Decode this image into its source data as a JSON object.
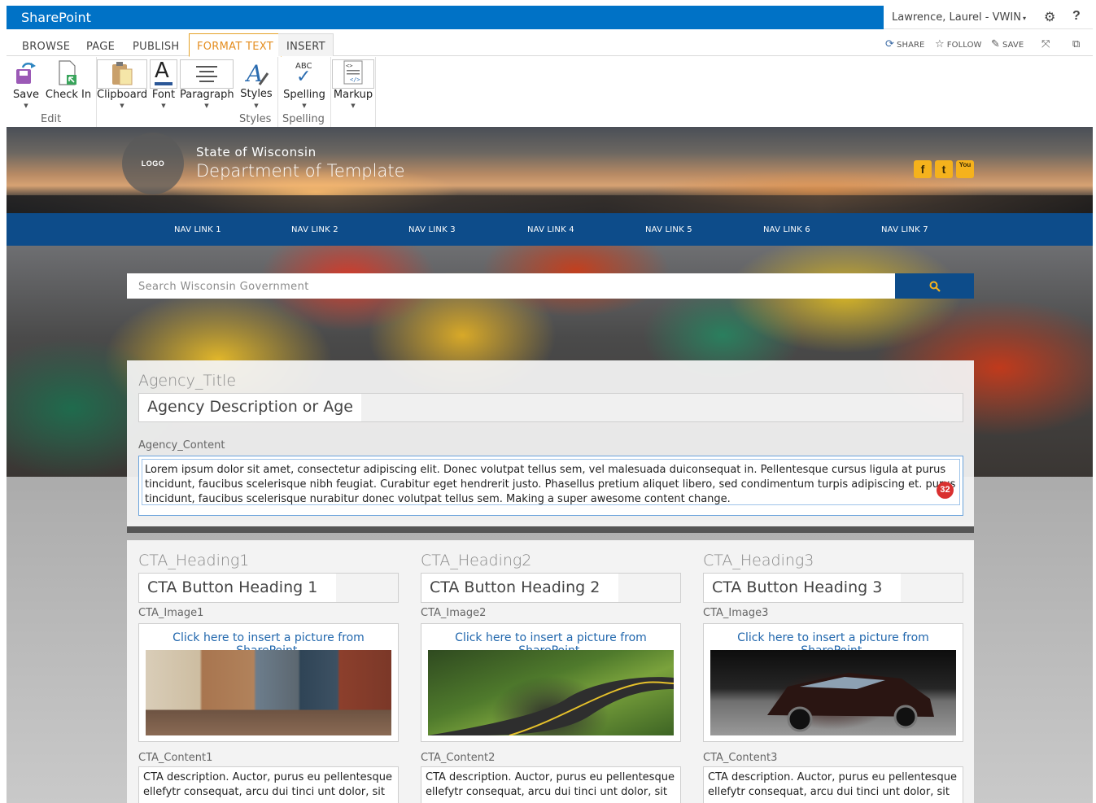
{
  "suitebar": {
    "brand": "SharePoint",
    "user": "Lawrence, Laurel - VWIN",
    "user_caret": "▾",
    "settings_icon": "gear-icon",
    "help": "?"
  },
  "ribbon": {
    "tabs": [
      "BROWSE",
      "PAGE",
      "PUBLISH",
      "FORMAT TEXT",
      "INSERT"
    ],
    "active_tab": "FORMAT TEXT",
    "actions": [
      "SHARE",
      "FOLLOW",
      "SAVE"
    ],
    "buttons": {
      "save": "Save",
      "check_in": "Check In",
      "clipboard": "Clipboard",
      "font": "Font",
      "paragraph": "Paragraph",
      "styles": "Styles",
      "spelling": "Spelling",
      "markup": "Markup"
    },
    "spelling_icon_text": "ABC",
    "font_icon_text": "A",
    "groups": [
      "Edit",
      "Styles",
      "Spelling"
    ]
  },
  "header": {
    "logo": "LOGO",
    "state": "State of Wisconsin",
    "department": "Department of Template",
    "social": [
      "facebook-icon",
      "twitter-icon",
      "youtube-icon"
    ],
    "social_glyphs": [
      "f",
      "t",
      "You"
    ]
  },
  "nav": {
    "links": [
      "NAV LINK 1",
      "NAV LINK 2",
      "NAV LINK 3",
      "NAV LINK 4",
      "NAV LINK 5",
      "NAV LINK 6",
      "NAV LINK 7"
    ]
  },
  "search": {
    "placeholder": "Search Wisconsin Government",
    "icon": "search-icon"
  },
  "agency": {
    "title_label": "Agency_Title",
    "description_value": "Agency Description or Age",
    "content_label": "Agency_Content",
    "content_text": "Lorem ipsum dolor sit amet, consectetur adipiscing elit. Donec volutpat tellus sem, vel malesuada duiconsequat in. Pellentesque cursus ligula at purus tincidunt, faucibus scelerisque nibh feugiat. Curabitur eget hendrerit justo. Phasellus pretium aliquet libero, sed condimentum turpis adipiscing et. purus tincidunt, faucibus scelerisque nurabitur donec volutpat tellus sem. Making a super awesome content change.",
    "spell_badge": "32"
  },
  "cta": [
    {
      "heading_label": "CTA_Heading1",
      "heading_value": "CTA Button Heading 1",
      "image_label": "CTA_Image1",
      "insert_text": "Click here to insert a picture from SharePoint.",
      "content_label": "CTA_Content1",
      "content_text": "CTA  description. Auctor, purus eu pellentesque ellefytr consequat, arcu dui tinci unt dolor, sit"
    },
    {
      "heading_label": "CTA_Heading2",
      "heading_value": "CTA Button Heading 2",
      "image_label": "CTA_Image2",
      "insert_text": "Click here to insert a picture from SharePoint.",
      "content_label": "CTA_Content2",
      "content_text": "CTA  description. Auctor, purus eu pellentesque ellefytr consequat, arcu dui tinci unt dolor, sit"
    },
    {
      "heading_label": "CTA_Heading3",
      "heading_value": "CTA Button Heading 3",
      "image_label": "CTA_Image3",
      "insert_text": "Click here to insert a picture from SharePoint.",
      "content_label": "CTA_Content3",
      "content_text": "CTA  description. Auctor, purus eu pellentesque ellefytr consequat, arcu dui tinci unt dolor, sit"
    }
  ],
  "colors": {
    "suitebar": "#0072c6",
    "nav": "#0d4c8a",
    "active_tab": "#e48d1f",
    "social": "#f5b21c",
    "badge": "#d9302f"
  }
}
